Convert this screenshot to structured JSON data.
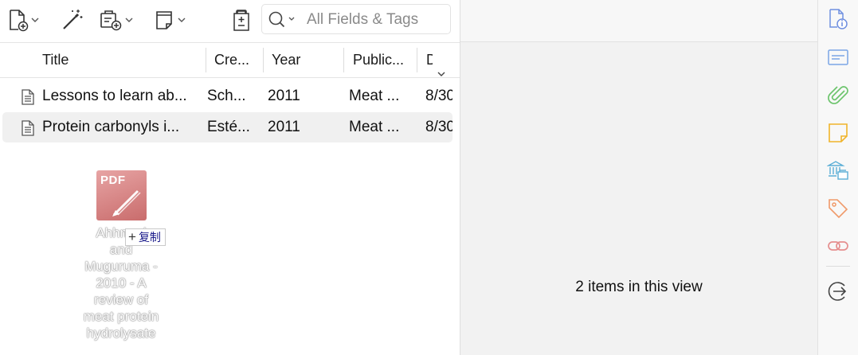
{
  "toolbar": {
    "new_item_icon": "new-item-icon",
    "magic_wand_icon": "add-by-identifier-icon",
    "new_attachment_icon": "add-attachment-icon",
    "new_note_icon": "new-note-icon",
    "locate_icon": "locate-icon",
    "search": {
      "placeholder": "All Fields & Tags",
      "value": "",
      "icon": "search-icon"
    }
  },
  "columns": [
    {
      "label": "Title"
    },
    {
      "label": "Cre..."
    },
    {
      "label": "Year"
    },
    {
      "label": "Public..."
    },
    {
      "label": "D"
    }
  ],
  "items": [
    {
      "title": "Lessons to learn ab...",
      "creator": "Sch...",
      "year": "2011",
      "publication": "Meat ...",
      "date": "8/30",
      "selected": false
    },
    {
      "title": "Protein carbonyls i...",
      "creator": "Esté...",
      "year": "2011",
      "publication": "Meat ...",
      "date": "8/30",
      "selected": true
    }
  ],
  "drag_ghost": {
    "thumb_label": "PDF",
    "filename": "Ahhmed and Muguruma - 2010 - A review of meat protein hydrolysate",
    "copy_badge": "复制",
    "copy_plus": "+"
  },
  "right_pane": {
    "items_count": "2 items in this view"
  },
  "side_strip": {
    "icons": [
      "info-icon",
      "abstract-icon",
      "attachments-icon",
      "notes-icon",
      "libraries-collections-icon",
      "tags-icon",
      "related-icon",
      "collapse-icon"
    ],
    "colors": {
      "info": "#6f8fe0",
      "abstract": "#7aa6e6",
      "attachments": "#6cc46c",
      "notes": "#f0b42a",
      "libraries": "#5aaed6",
      "tags": "#f09a6a",
      "related": "#e58f8f",
      "collapse": "#444444"
    }
  }
}
